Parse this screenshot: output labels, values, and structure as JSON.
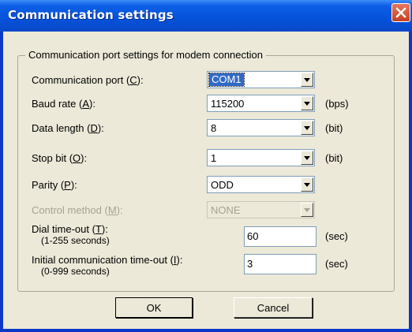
{
  "window": {
    "title": "Communication settings",
    "close_icon": "close-icon"
  },
  "group": {
    "title": "Communication port settings for modem connection"
  },
  "fields": {
    "comm_port": {
      "label_pre": "Communication port (",
      "mnemonic": "C",
      "label_post": "):",
      "value": "COM1"
    },
    "baud_rate": {
      "label_pre": "Baud rate (",
      "mnemonic": "A",
      "label_post": "):",
      "value": "115200",
      "unit": "(bps)"
    },
    "data_length": {
      "label_pre": "Data length (",
      "mnemonic": "D",
      "label_post": "):",
      "value": "8",
      "unit": "(bit)"
    },
    "stop_bit": {
      "label_pre": "Stop bit (",
      "mnemonic": "O",
      "label_post": "):",
      "value": "1",
      "unit": "(bit)"
    },
    "parity": {
      "label_pre": "Parity (",
      "mnemonic": "P",
      "label_post": "):",
      "value": "ODD"
    },
    "control_method": {
      "label_pre": "Control method (",
      "mnemonic": "M",
      "label_post": "):",
      "value": "NONE"
    },
    "dial_timeout": {
      "label_pre": "Dial time-out (",
      "mnemonic": "T",
      "label_post": "):",
      "hint": "(1-255 seconds)",
      "value": "60",
      "unit": "(sec)"
    },
    "init_timeout": {
      "label_pre": "Initial communication time-out (",
      "mnemonic": "I",
      "label_post": "):",
      "hint": "(0-999 seconds)",
      "value": "3",
      "unit": "(sec)"
    }
  },
  "buttons": {
    "ok": "OK",
    "cancel": "Cancel"
  },
  "colors": {
    "title_bar": "#0552da",
    "dialog_bg": "#ece9d8",
    "selection": "#316ac5",
    "close_button": "#d4502c"
  }
}
